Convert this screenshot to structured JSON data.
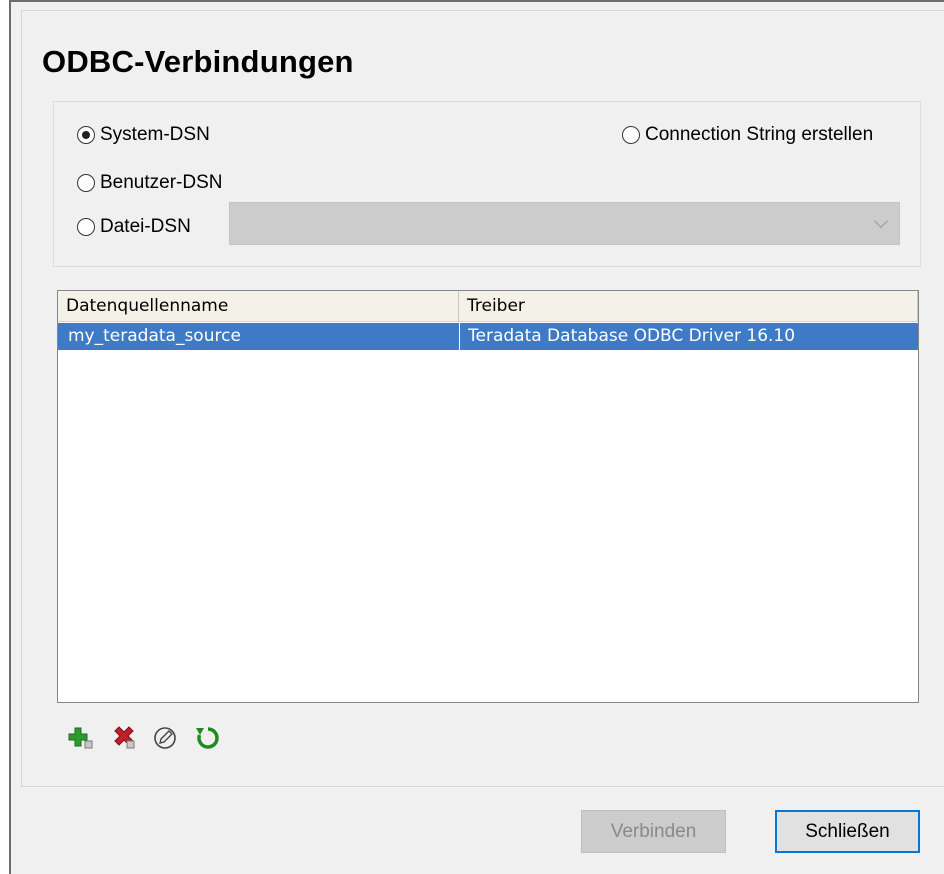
{
  "dialog": {
    "title": "ODBC-Verbindungen"
  },
  "dsn_options": {
    "system_dsn": "System-DSN",
    "user_dsn": "Benutzer-DSN",
    "file_dsn": "Datei-DSN",
    "connection_string": "Connection String erstellen",
    "selected": "System-DSN",
    "file_dsn_dropdown_value": ""
  },
  "table": {
    "columns": [
      "Datenquellenname",
      "Treiber"
    ],
    "rows": [
      {
        "name": "my_teradata_source",
        "driver": "Teradata Database ODBC Driver 16.10",
        "selected": true
      }
    ]
  },
  "toolbar": {
    "icons": [
      "add-icon",
      "delete-icon",
      "edit-icon",
      "refresh-icon"
    ]
  },
  "buttons": {
    "connect": "Verbinden",
    "close": "Schließen"
  },
  "colors": {
    "selection": "#3e7ac6",
    "focus_border": "#0078d7",
    "add_green": "#2e9b2e",
    "delete_red": "#c0202a"
  }
}
